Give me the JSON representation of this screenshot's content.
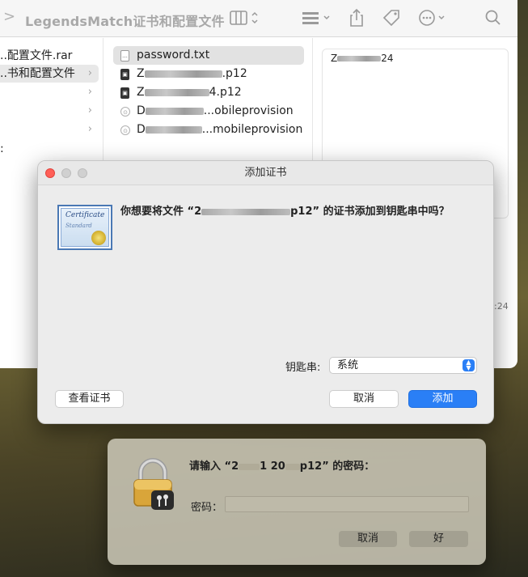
{
  "finder": {
    "title": "LegendsMatch证书和配置文件",
    "back_glyph": ">",
    "sidebar_items": [
      {
        "label": "..配置文件.rar",
        "chevron": ""
      },
      {
        "label": "..书和配置文件",
        "chevron": "›"
      },
      {
        "label": "",
        "chevron": "›"
      },
      {
        "label": "",
        "chevron": "›"
      },
      {
        "label": "",
        "chevron": "›"
      }
    ],
    "left_edge_char": ":",
    "files": [
      {
        "name": "password.txt",
        "prefix": "",
        "suffix": "",
        "icon": "txt"
      },
      {
        "prefix": "Z",
        "suffix": ".p12",
        "icon": "p12"
      },
      {
        "prefix": "Z",
        "suffix": "4.p12",
        "icon": "p12"
      },
      {
        "prefix": "D",
        "suffix": "...obileprovision",
        "icon": "provision"
      },
      {
        "prefix": "D",
        "suffix": "...mobileprovision",
        "icon": "provision"
      }
    ],
    "preview": {
      "prefix": "Z",
      "suffix": "24"
    },
    "edge_text": ":24",
    "toolbar_icons": [
      "column-view-icon",
      "group-icon",
      "share-icon",
      "tag-icon",
      "more-icon",
      "search-icon"
    ]
  },
  "dialog": {
    "title": "添加证书",
    "question_prefix": "你想要将文件 “2",
    "question_suffix": "p12” 的证书添加到钥匙串中吗？",
    "cert_word1": "Certificate",
    "cert_word2": "Standard",
    "keychain_label": "钥匙串:",
    "keychain_value": "系统",
    "view_cert_button": "查看证书",
    "cancel_button": "取消",
    "add_button": "添加"
  },
  "password_dialog": {
    "prompt_prefix": "请输入 “2",
    "prompt_mid": "1 20",
    "prompt_suffix": "p12” 的密码：",
    "password_label": "密码：",
    "password_value": "",
    "cancel_button": "取消",
    "ok_button": "好"
  },
  "colors": {
    "accent": "#2a7ff6",
    "close": "#ff5f57",
    "inactive_traffic": "#d0d0d0"
  }
}
